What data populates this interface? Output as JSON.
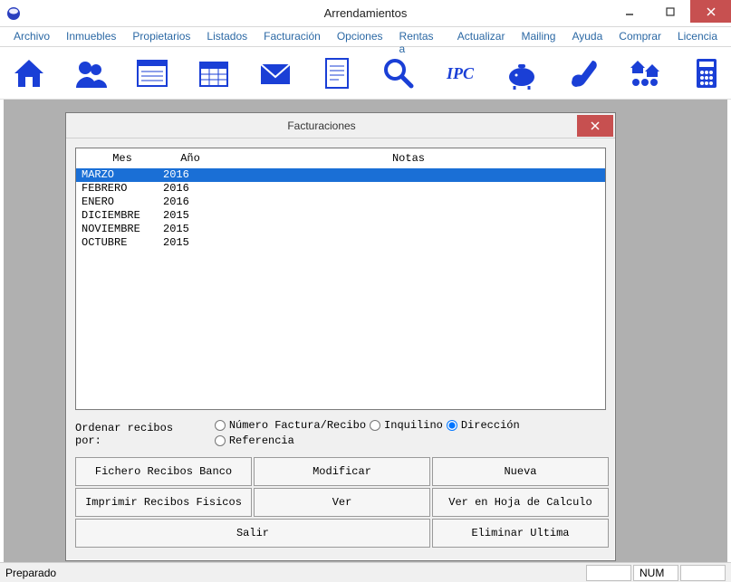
{
  "window": {
    "title": "Arrendamientos"
  },
  "menu": {
    "items": [
      "Archivo",
      "Inmuebles",
      "Propietarios",
      "Listados",
      "Facturación",
      "Opciones",
      "Rentas a",
      "Actualizar",
      "Mailing",
      "Ayuda",
      "Comprar",
      "Licencia"
    ]
  },
  "toolbar": {
    "icons": [
      "house-icon",
      "people-icon",
      "form-icon",
      "calendar-icon",
      "mail-icon",
      "document-icon",
      "magnifier-icon",
      "ipc-icon",
      "piggy-icon",
      "pour-icon",
      "houses-group-icon",
      "calculator-icon"
    ]
  },
  "modal": {
    "title": "Facturaciones",
    "headers": {
      "mes": "Mes",
      "ano": "Año",
      "notas": "Notas"
    },
    "rows": [
      {
        "mes": "MARZO",
        "ano": "2016",
        "notas": "",
        "selected": true
      },
      {
        "mes": "FEBRERO",
        "ano": "2016",
        "notas": "",
        "selected": false
      },
      {
        "mes": "ENERO",
        "ano": "2016",
        "notas": "",
        "selected": false
      },
      {
        "mes": "DICIEMBRE",
        "ano": "2015",
        "notas": "",
        "selected": false
      },
      {
        "mes": "NOVIEMBRE",
        "ano": "2015",
        "notas": "",
        "selected": false
      },
      {
        "mes": "OCTUBRE",
        "ano": "2015",
        "notas": "",
        "selected": false
      }
    ],
    "sort": {
      "label": "Ordenar recibos por:",
      "options": [
        {
          "label": "Número Factura/Recibo",
          "checked": false
        },
        {
          "label": "Inquilino",
          "checked": false
        },
        {
          "label": "Dirección",
          "checked": true
        },
        {
          "label": "Referencia",
          "checked": false
        }
      ]
    },
    "buttons": {
      "fichero": "Fichero Recibos Banco",
      "modificar": "Modificar",
      "nueva": "Nueva",
      "imprimir": "Imprimir Recibos Fisicos",
      "ver": "Ver",
      "ver_hoja": "Ver en Hoja de Calculo",
      "salir": "Salir",
      "eliminar": "Eliminar Ultima"
    }
  },
  "status": {
    "left": "Preparado",
    "num": "NUM"
  }
}
